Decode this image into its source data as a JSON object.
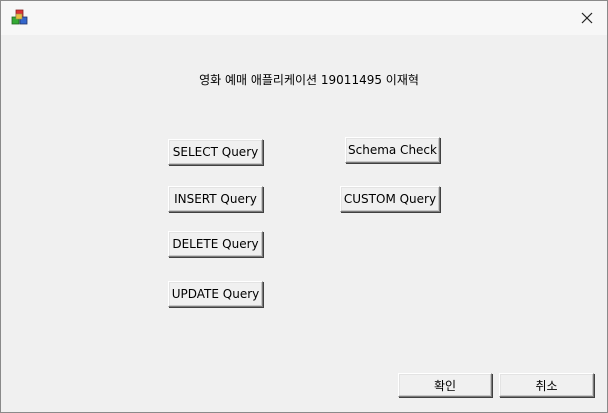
{
  "window": {
    "icon": "app-icon",
    "close_icon": "close-icon"
  },
  "heading": "영화 예매 애플리케이션 19011495 이재혁",
  "buttons": {
    "select": "SELECT Query",
    "insert": "INSERT Query",
    "delete": "DELETE Query",
    "update": "UPDATE Query",
    "schema": "Schema Check",
    "custom": "CUSTOM Query",
    "ok": "확인",
    "cancel": "취소"
  },
  "colors": {
    "window_bg": "#f0f0f0",
    "titlebar_bg": "#f7f7f7"
  }
}
